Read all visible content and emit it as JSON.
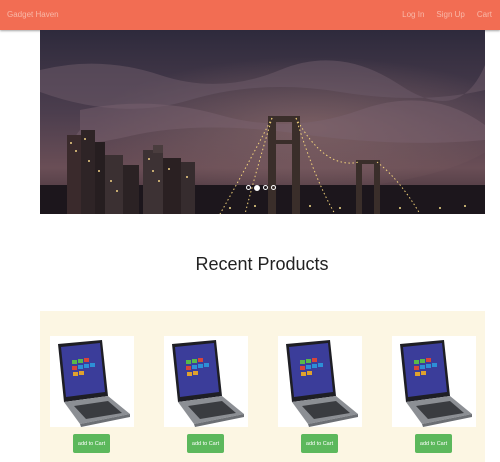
{
  "navbar": {
    "brand": "Gadget Haven",
    "links": [
      "Log In",
      "Sign Up",
      "Cart"
    ]
  },
  "carousel": {
    "slide_count": 4,
    "active_index": 1
  },
  "section": {
    "title": "Recent Products"
  },
  "products": [
    {
      "button_label": "add to Cart"
    },
    {
      "button_label": "add to Cart"
    },
    {
      "button_label": "add to Cart"
    },
    {
      "button_label": "add to Cart"
    }
  ],
  "colors": {
    "navbar": "#f26d53",
    "panel": "#fcf6e3",
    "button": "#5cb85c"
  }
}
